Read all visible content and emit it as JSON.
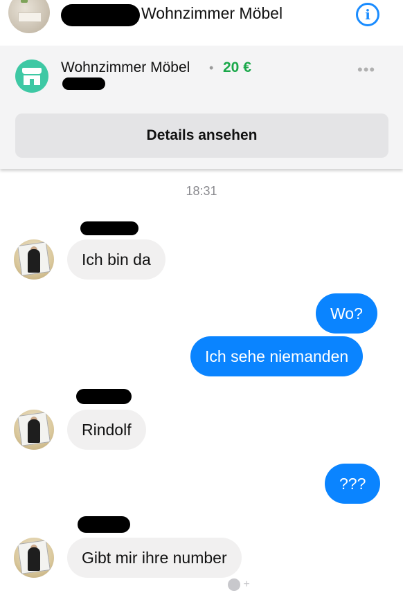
{
  "header": {
    "title": "Wohnzimmer Möbel",
    "info_icon": "info-icon"
  },
  "listing": {
    "title": "Wohnzimmer Möbel",
    "separator": "•",
    "price": "20 €",
    "more_icon": "•••",
    "details_button": "Details ansehen",
    "price_color": "#1aa84a",
    "icon_color": "#3ec8a4"
  },
  "chat": {
    "timestamp": "18:31",
    "messages": [
      {
        "direction": "in",
        "text": "Ich bin da"
      },
      {
        "direction": "out",
        "text": "Wo?"
      },
      {
        "direction": "out",
        "text": "Ich sehe niemanden"
      },
      {
        "direction": "in",
        "text": "Rindolf"
      },
      {
        "direction": "out",
        "text": "???"
      },
      {
        "direction": "in",
        "text": "Gibt mir ihre number"
      }
    ],
    "outgoing_color": "#0a84ff",
    "incoming_color": "#f1f0f0",
    "reaction_plus": "+"
  }
}
